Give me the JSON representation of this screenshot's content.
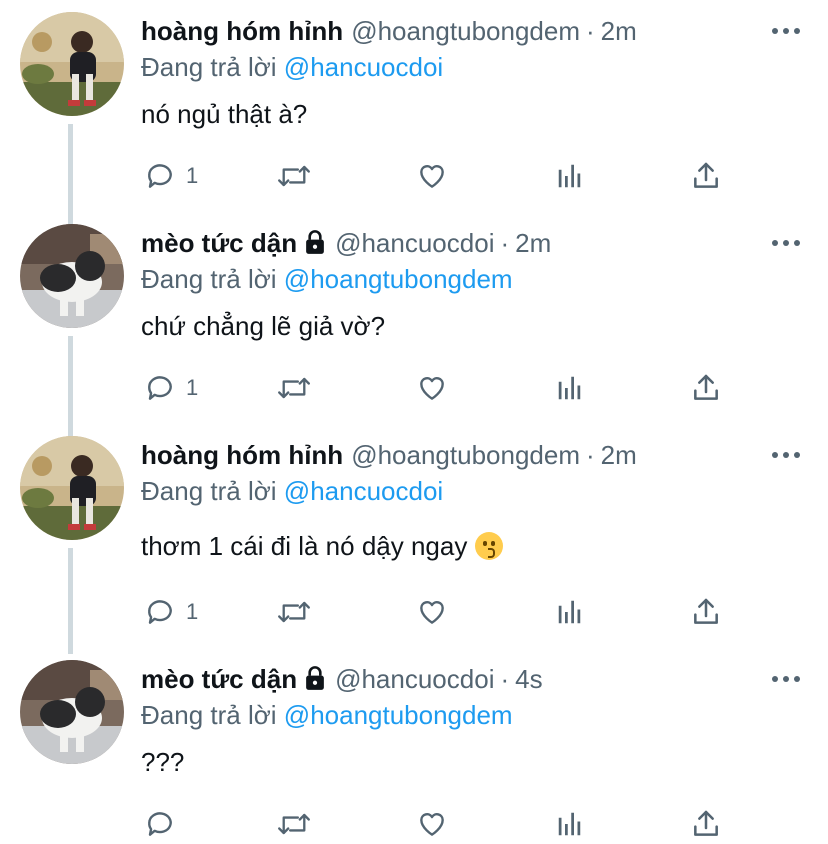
{
  "tweets": [
    {
      "name": "hoàng hóm hỉnh",
      "handle": "@hoangtubongdem",
      "dot": "·",
      "time": "2m",
      "replying_prefix": "Đang trả lời",
      "replying_to": "@hancuocdoi",
      "text": "nó ngủ thật à?",
      "reply_count": "1",
      "locked": false,
      "avatar": "boy-sitting-photo"
    },
    {
      "name": "mèo tức dận",
      "handle": "@hancuocdoi",
      "dot": "·",
      "time": "2m",
      "replying_prefix": "Đang trả lời",
      "replying_to": "@hoangtubongdem",
      "text": "chứ chẳng lẽ giả vờ?",
      "reply_count": "1",
      "locked": true,
      "avatar": "cat-photo"
    },
    {
      "name": "hoàng hóm hỉnh",
      "handle": "@hoangtubongdem",
      "dot": "·",
      "time": "2m",
      "replying_prefix": "Đang trả lời",
      "replying_to": "@hancuocdoi",
      "text": "thơm 1 cái đi là nó dậy ngay",
      "emoji": "kissing-face-emoji",
      "reply_count": "1",
      "locked": false,
      "avatar": "boy-sitting-photo"
    },
    {
      "name": "mèo tức dận",
      "handle": "@hancuocdoi",
      "dot": "·",
      "time": "4s",
      "replying_prefix": "Đang trả lời",
      "replying_to": "@hoangtubongdem",
      "text": "???",
      "reply_count": "",
      "locked": true,
      "avatar": "cat-photo"
    }
  ],
  "colors": {
    "text": "#0f1419",
    "secondary": "#536471",
    "mention": "#1d9bf0",
    "thread_line": "#cfd9de"
  }
}
